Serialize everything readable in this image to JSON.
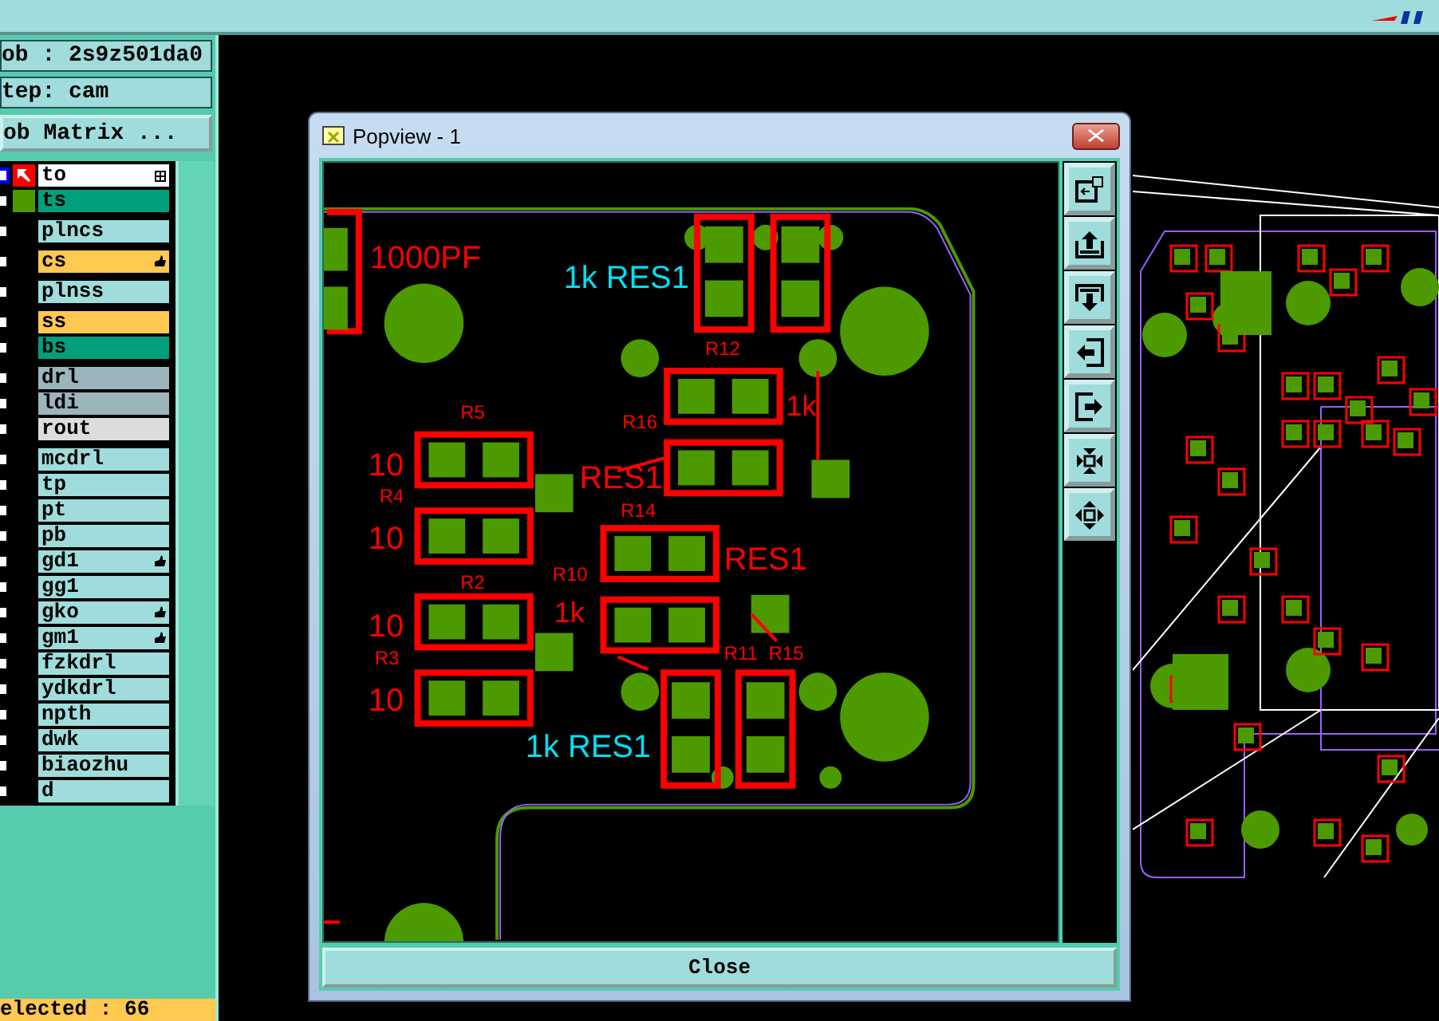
{
  "job_field": "ob : 2s9z501da0",
  "step_field": "tep: cam",
  "matrix_button": "ob Matrix ...",
  "layer_groups": [
    [
      {
        "name": "to",
        "color": "#ffffff",
        "hand": false,
        "selected": true,
        "kind": "work"
      },
      {
        "name": "ts",
        "color": "#00a07c",
        "hand": false,
        "selected": false,
        "kind": "displayed"
      }
    ],
    [
      {
        "name": "plncs",
        "color": "#a0dcdc",
        "hand": false,
        "selected": false
      }
    ],
    [
      {
        "name": "cs",
        "color": "#ffc850",
        "hand": true,
        "selected": false
      }
    ],
    [
      {
        "name": "plnss",
        "color": "#a0dcdc",
        "hand": false,
        "selected": false
      }
    ],
    [
      {
        "name": "ss",
        "color": "#ffc850",
        "hand": false,
        "selected": false
      },
      {
        "name": "bs",
        "color": "#00a07c",
        "hand": false,
        "selected": false
      }
    ],
    [
      {
        "name": "drl",
        "color": "#9cb4bc",
        "hand": false,
        "selected": false
      },
      {
        "name": "ldi",
        "color": "#9cb4bc",
        "hand": false,
        "selected": false
      },
      {
        "name": "rout",
        "color": "#dcdcdc",
        "hand": false,
        "selected": false
      }
    ],
    [
      {
        "name": "mcdrl",
        "color": "#a0dcdc",
        "hand": false,
        "selected": false
      },
      {
        "name": "tp",
        "color": "#a0dcdc",
        "hand": false,
        "selected": false
      },
      {
        "name": "pt",
        "color": "#a0dcdc",
        "hand": false,
        "selected": false
      },
      {
        "name": "pb",
        "color": "#a0dcdc",
        "hand": false,
        "selected": false
      },
      {
        "name": "gd1",
        "color": "#a0dcdc",
        "hand": true,
        "selected": false
      },
      {
        "name": "gg1",
        "color": "#a0dcdc",
        "hand": false,
        "selected": false
      },
      {
        "name": "gko",
        "color": "#a0dcdc",
        "hand": true,
        "selected": false
      },
      {
        "name": "gm1",
        "color": "#a0dcdc",
        "hand": true,
        "selected": false
      },
      {
        "name": "fzkdrl",
        "color": "#a0dcdc",
        "hand": false,
        "selected": false
      },
      {
        "name": "ydkdrl",
        "color": "#a0dcdc",
        "hand": false,
        "selected": false
      },
      {
        "name": "npth",
        "color": "#a0dcdc",
        "hand": false,
        "selected": false
      },
      {
        "name": "dwk",
        "color": "#a0dcdc",
        "hand": false,
        "selected": false
      },
      {
        "name": "biaozhu",
        "color": "#a0dcdc",
        "hand": false,
        "selected": false
      },
      {
        "name": "d",
        "color": "#a0dcdc",
        "hand": false,
        "selected": false
      }
    ]
  ],
  "status": "elected : 66",
  "popup": {
    "title": "Popview - 1",
    "close_button": "Close",
    "labels": [
      {
        "text": "1000PF",
        "color": "#ff0000"
      },
      {
        "text": "1k RES1",
        "color": "#00e0f0"
      },
      {
        "text": "R12",
        "color": "#ff0000"
      },
      {
        "text": "R5",
        "color": "#ff0000"
      },
      {
        "text": "R16",
        "color": "#ff0000"
      },
      {
        "text": "1k",
        "color": "#ff0000"
      },
      {
        "text": "10",
        "color": "#ff0000"
      },
      {
        "text": "R4",
        "color": "#ff0000"
      },
      {
        "text": "RES1",
        "color": "#ff0000"
      },
      {
        "text": "R14",
        "color": "#ff0000"
      },
      {
        "text": "10",
        "color": "#ff0000"
      },
      {
        "text": "R2",
        "color": "#ff0000"
      },
      {
        "text": "R10",
        "color": "#ff0000"
      },
      {
        "text": "RES1",
        "color": "#ff0000"
      },
      {
        "text": "1k",
        "color": "#ff0000"
      },
      {
        "text": "10",
        "color": "#ff0000"
      },
      {
        "text": "R3",
        "color": "#ff0000"
      },
      {
        "text": "10",
        "color": "#ff0000"
      },
      {
        "text": "R11",
        "color": "#ff0000"
      },
      {
        "text": "R15",
        "color": "#ff0000"
      },
      {
        "text": "1k RES1",
        "color": "#00e0f0"
      }
    ]
  }
}
